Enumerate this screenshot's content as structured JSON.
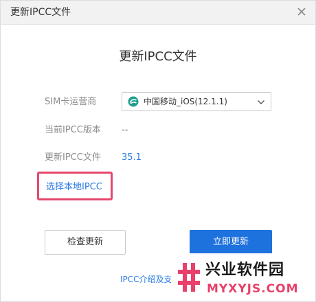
{
  "window": {
    "title": "更新IPCC文件"
  },
  "dialog": {
    "heading": "更新IPCC文件",
    "carrier_label": "SIM卡运营商",
    "carrier_select": {
      "selected": "中国移动_iOS(12.1.1)"
    },
    "current_version_label": "当前IPCC版本",
    "current_version_value": "--",
    "update_file_label": "更新IPCC文件",
    "update_file_value": "35.1",
    "choose_local_link": "选择本地IPCC",
    "check_button": "检查更新",
    "update_button": "立即更新",
    "intro_link": "IPCC介绍及支"
  },
  "watermark": {
    "name": "兴业软件园",
    "domain": "MYXYJS.COM"
  },
  "colors": {
    "accent": "#1e72de",
    "link": "#2a7ae2",
    "highlight": "#e5466b",
    "carrier_logo": "#1d9e8c",
    "watermark_pink": "#e8406a"
  },
  "icons": {
    "close": "close-icon",
    "carrier": "china-mobile-logo-icon",
    "dropdown": "chevron-down-icon",
    "watermark": "hash-logo-icon"
  }
}
